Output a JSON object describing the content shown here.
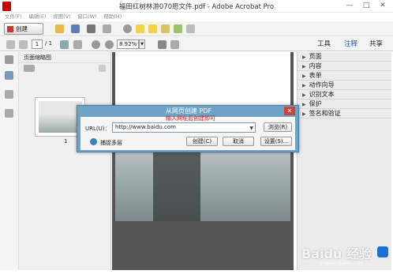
{
  "window": {
    "title": "福田红树林游070愿文件.pdf - Adobe Acrobat Pro",
    "minimize": "—",
    "maximize": "□",
    "close": "✕"
  },
  "menu": [
    "文件(F)",
    "编辑(E)",
    "视图(V)",
    "窗口(W)",
    "帮助(H)"
  ],
  "toolbar": {
    "create_label": "创建"
  },
  "nav": {
    "page_current": "1",
    "page_total": "/ 1",
    "zoom": "8.92%"
  },
  "tabs": {
    "tools": "工具",
    "comment": "注释",
    "share": "共享"
  },
  "left_panel": {
    "title": "页面缩略图",
    "thumb_page_num": "1"
  },
  "right_panel": {
    "items": [
      "页面",
      "内容",
      "表单",
      "动作向导",
      "识别文本",
      "保护",
      "签名和验证"
    ]
  },
  "dialog": {
    "title": "从网页创建 PDF",
    "close": "✕",
    "url_label": "URL(U)：",
    "url_value": "http://www.baidu.com",
    "hint": "输入网址后创建即可",
    "browse_label": "浏览(R)",
    "capture_label": "捕捉多层",
    "create_label": "创建(C)",
    "cancel_label": "取消",
    "settings_label": "设置(S)..."
  },
  "watermark": {
    "text": "Baidu 经验",
    "sub": "jingyan.baidu.com"
  },
  "colors": {
    "dialog_frame": "#6fa3c6",
    "hint_red": "#e01010",
    "accent_blue": "#1d6fd1"
  }
}
